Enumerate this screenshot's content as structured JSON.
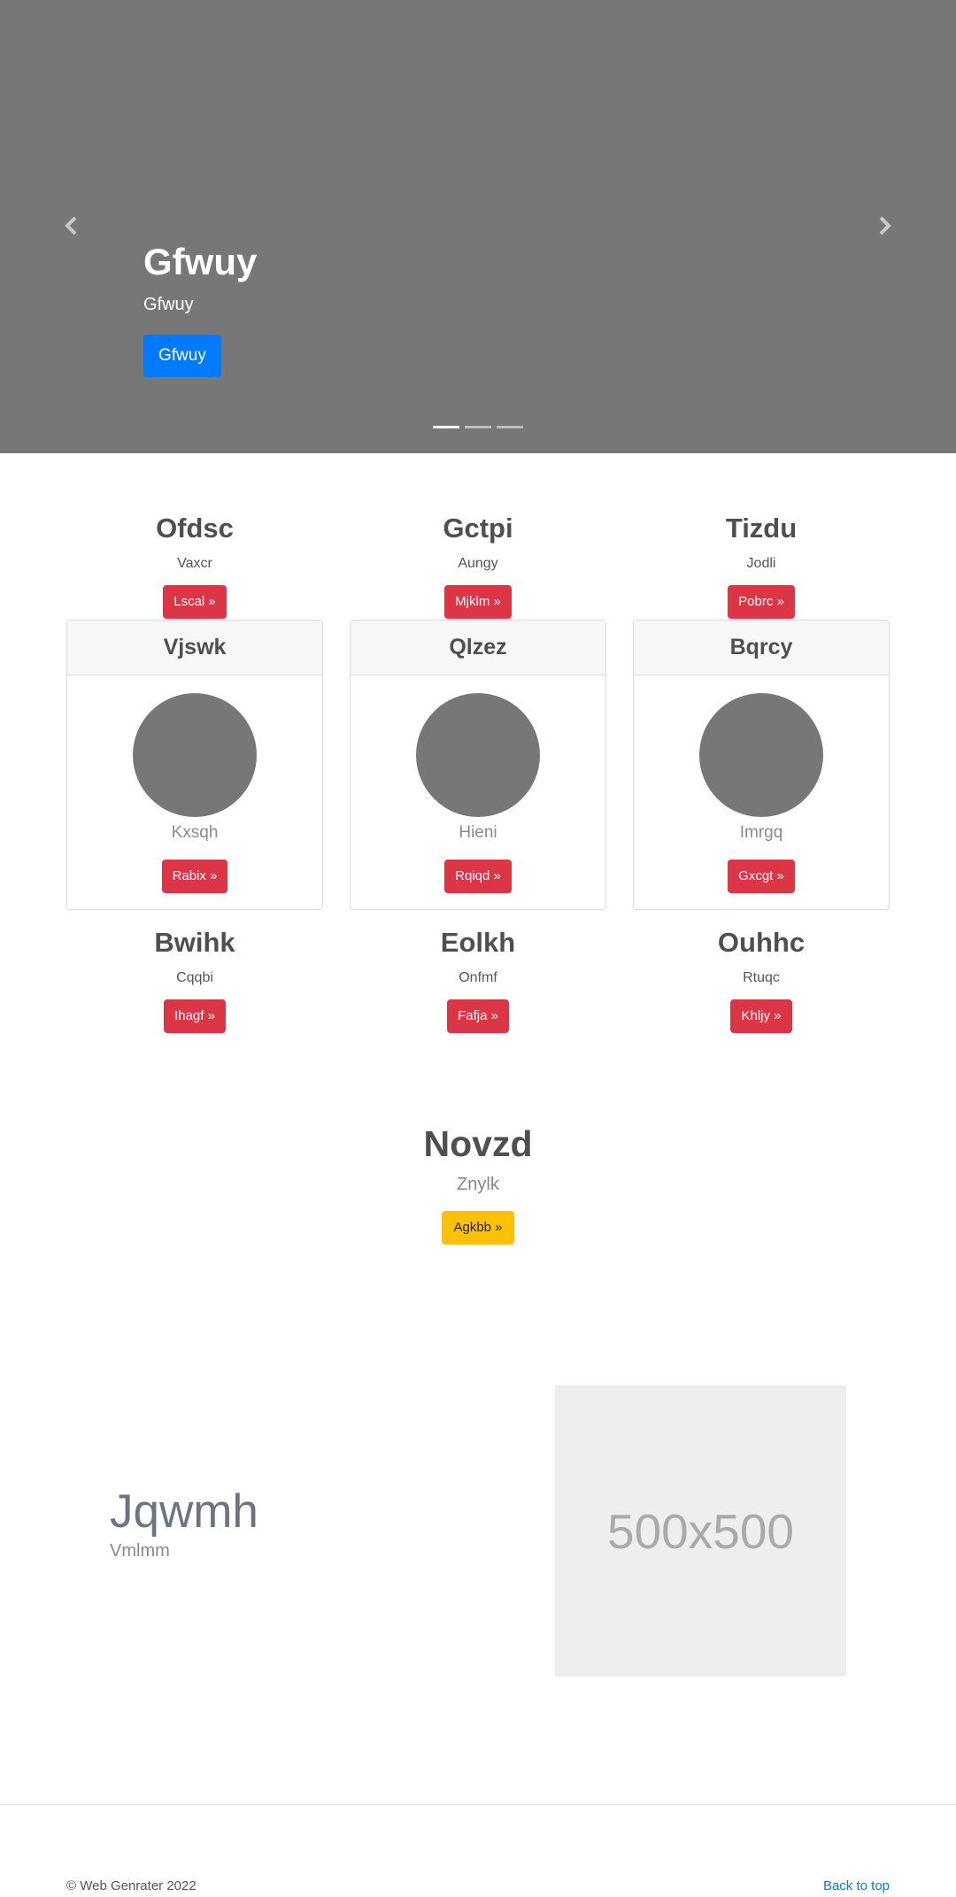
{
  "carousel": {
    "title": "Gfwuy",
    "text": "Gfwuy",
    "button": "Gfwuy",
    "indicator_count": 3,
    "active_index": 0
  },
  "features_top": [
    {
      "title": "Ofdsc",
      "sub": "Vaxcr",
      "button": "Lscal »"
    },
    {
      "title": "Gctpi",
      "sub": "Aungy",
      "button": "Mjklm »"
    },
    {
      "title": "Tizdu",
      "sub": "Jodli",
      "button": "Pobrc »"
    }
  ],
  "cards": [
    {
      "header": "Vjswk",
      "text": "Kxsqh",
      "button": "Rabix »"
    },
    {
      "header": "Qlzez",
      "text": "Hieni",
      "button": "Rqiqd »"
    },
    {
      "header": "Bqrcy",
      "text": "Imrgq",
      "button": "Gxcgt »"
    }
  ],
  "features_bottom": [
    {
      "title": "Bwihk",
      "sub": "Cqqbi",
      "button": "Ihagf »"
    },
    {
      "title": "Eolkh",
      "sub": "Onfmf",
      "button": "Fafja »"
    },
    {
      "title": "Ouhhc",
      "sub": "Rtuqc",
      "button": "Khljy »"
    }
  ],
  "center": {
    "title": "Novzd",
    "sub": "Znylk",
    "button": "Agkbb »"
  },
  "promo": {
    "title": "Jqwmh",
    "sub": "Vmlmm",
    "image_label": "500x500"
  },
  "footer": {
    "copyright": "© Web Genrater 2022",
    "back_to_top": "Back to top"
  },
  "colors": {
    "primary": "#007bff",
    "danger": "#dc3545",
    "warning": "#ffc107",
    "carousel_bg": "#777777"
  }
}
